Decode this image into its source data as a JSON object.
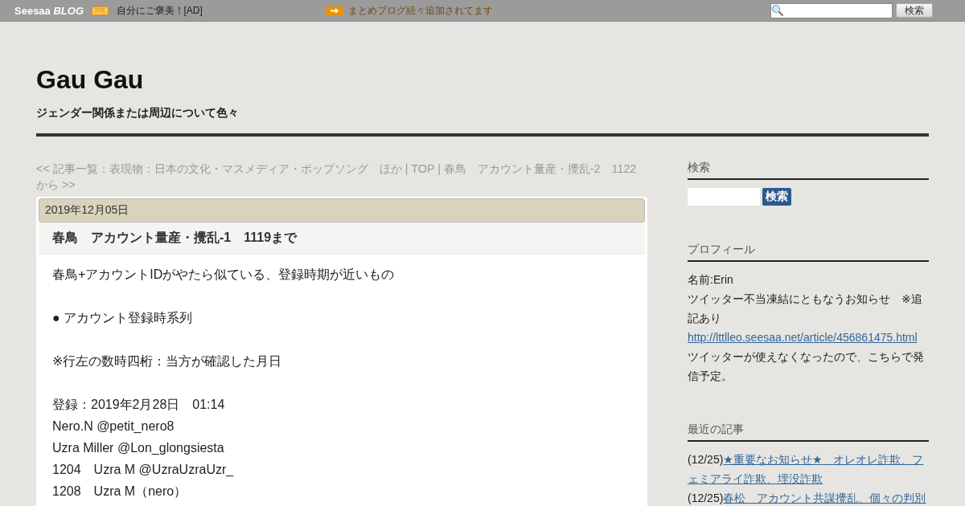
{
  "topbar": {
    "logo": "Seesaa",
    "logo_suffix": "BLOG",
    "pr_badge": "PR",
    "ad_text": "自分にご褒美！[AD]",
    "notice": "まとめブログ続々追加されてます",
    "search_button": "検索"
  },
  "blog": {
    "title": "Gau Gau",
    "subtitle": "ジェンダー関係または周辺について色々"
  },
  "breadcrumb": "<< 記事一覧：表現物：日本の文化・マスメディア・ポップソング　ほか | TOP | 春鳥　アカウント量産・攪乱-2　1122から >>",
  "article": {
    "date": "2019年12月05日",
    "title": "春鳥　アカウント量産・攪乱-1　1119まで",
    "paragraphs": [
      [
        "春鳥+アカウントIDがやたら似ている、登録時期が近いもの"
      ],
      [
        "● アカウント登録時系列"
      ],
      [
        "※行左の数時四桁：当方が確認した月日"
      ],
      [
        "登録：2019年2月28日　01:14",
        "Nero.N @petit_nero8",
        "Uzra Miller @Lon_glongsiesta",
        "1204　Uzra M @UzraUzraUzr_",
        "1208　Uzra M（nero）"
      ]
    ]
  },
  "sidebar": [
    {
      "kind": "search",
      "heading": "検索",
      "button": "検索"
    },
    {
      "kind": "profile",
      "heading": "プロフィール",
      "name": "名前:Erin",
      "notice": "ツイッター不当凍結にともなうお知らせ　※追記あり",
      "link": "http://lttlleo.seesaa.net/article/456861475.html",
      "message": "ツイッターが使えなくなったので、こちらで発信予定。"
    },
    {
      "kind": "recent",
      "heading": "最近の記事",
      "items": [
        {
          "date": "(12/25)",
          "title": "★重要なお知らせ★　オレオレ詐欺、フェミアライ詐欺、埋没詐欺"
        },
        {
          "date": "(12/25)",
          "title": "春松　アカウント共謀攪乱、個々の判別"
        }
      ]
    }
  ]
}
